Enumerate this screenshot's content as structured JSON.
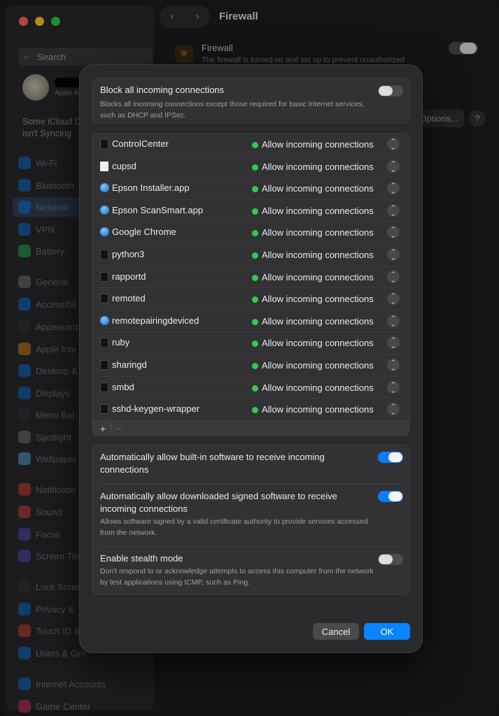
{
  "sidebar": {
    "search_placeholder": "Search",
    "profile_sub": "Apple A",
    "icloud_note": "Some iCloud D\nisn't Syncing",
    "items": [
      {
        "label": "Wi-Fi",
        "icon": "wifi-icon",
        "color": "#0a84ff"
      },
      {
        "label": "Bluetooth",
        "icon": "bluetooth-icon",
        "color": "#0a84ff"
      },
      {
        "label": "Network",
        "icon": "globe-icon",
        "color": "#0a84ff",
        "selected": true
      },
      {
        "label": "VPN",
        "icon": "vpn-icon",
        "color": "#0a84ff"
      },
      {
        "label": "Battery",
        "icon": "battery-icon",
        "color": "#30d158"
      },
      {
        "label": "General",
        "icon": "gear-icon",
        "color": "#8e8e93"
      },
      {
        "label": "Accessibil",
        "icon": "accessibility-icon",
        "color": "#0a84ff"
      },
      {
        "label": "Appearanc",
        "icon": "appearance-icon",
        "color": "#3a3a3c"
      },
      {
        "label": "Apple Inte",
        "icon": "apple-intelligence-icon",
        "color": "#ff9f0a"
      },
      {
        "label": "Desktop &",
        "icon": "desktop-icon",
        "color": "#0a84ff"
      },
      {
        "label": "Displays",
        "icon": "displays-icon",
        "color": "#0a84ff"
      },
      {
        "label": "Menu Bar",
        "icon": "menubar-icon",
        "color": "#3a3a3c"
      },
      {
        "label": "Spotlight",
        "icon": "spotlight-icon",
        "color": "#8e8e93"
      },
      {
        "label": "Wallpaper",
        "icon": "wallpaper-icon",
        "color": "#64d2ff"
      },
      {
        "label": "Notificatio",
        "icon": "notifications-icon",
        "color": "#ff453a"
      },
      {
        "label": "Sound",
        "icon": "sound-icon",
        "color": "#ff453a"
      },
      {
        "label": "Focus",
        "icon": "focus-icon",
        "color": "#5e5ce6"
      },
      {
        "label": "Screen Tim",
        "icon": "screentime-icon",
        "color": "#5e5ce6"
      },
      {
        "label": "Lock Scree",
        "icon": "lock-icon",
        "color": "#3a3a3c"
      },
      {
        "label": "Privacy &",
        "icon": "privacy-icon",
        "color": "#0a84ff"
      },
      {
        "label": "Touch ID &",
        "icon": "fingerprint-icon",
        "color": "#ff453a"
      },
      {
        "label": "Users & Gro",
        "icon": "users-icon",
        "color": "#0a84ff"
      },
      {
        "label": "Internet Accounts",
        "icon": "at-icon",
        "color": "#0a84ff"
      },
      {
        "label": "Game Center",
        "icon": "gamecenter-icon",
        "color": "#ff375f"
      }
    ]
  },
  "header": {
    "title": "Firewall",
    "back_icon": "chevron-left-icon",
    "forward_icon": "chevron-right-icon"
  },
  "firewall": {
    "label": "Firewall",
    "desc": "The firewall is turned on and set up to prevent unauthorized",
    "options_label": "Options...",
    "help_label": "?"
  },
  "dialog": {
    "block_all": {
      "title": "Block all incoming connections",
      "desc": "Blocks all incoming connections except those required for basic Internet services, such as DHCP and IPSec.",
      "enabled": false
    },
    "apps": [
      {
        "name": "ControlCenter",
        "icon": "terminal",
        "status": "Allow incoming connections"
      },
      {
        "name": "cupsd",
        "icon": "document",
        "status": "Allow incoming connections"
      },
      {
        "name": "Epson Installer.app",
        "icon": "app",
        "status": "Allow incoming connections"
      },
      {
        "name": "Epson ScanSmart.app",
        "icon": "app",
        "status": "Allow incoming connections"
      },
      {
        "name": "Google Chrome",
        "icon": "app",
        "status": "Allow incoming connections"
      },
      {
        "name": "python3",
        "icon": "terminal",
        "status": "Allow incoming connections"
      },
      {
        "name": "rapportd",
        "icon": "terminal",
        "status": "Allow incoming connections"
      },
      {
        "name": "remoted",
        "icon": "terminal",
        "status": "Allow incoming connections"
      },
      {
        "name": "remotepairingdeviced",
        "icon": "app",
        "status": "Allow incoming connections"
      },
      {
        "name": "ruby",
        "icon": "terminal",
        "status": "Allow incoming connections"
      },
      {
        "name": "sharingd",
        "icon": "terminal",
        "status": "Allow incoming connections"
      },
      {
        "name": "smbd",
        "icon": "terminal",
        "status": "Allow incoming connections"
      },
      {
        "name": "sshd-keygen-wrapper",
        "icon": "terminal",
        "status": "Allow incoming connections"
      }
    ],
    "list_footer": {
      "add": "+",
      "remove": "−"
    },
    "auto_builtin": {
      "title": "Automatically allow built-in software to receive incoming connections",
      "enabled": true
    },
    "auto_signed": {
      "title": "Automatically allow downloaded signed software to receive incoming connections",
      "desc": "Allows software signed by a valid certificate authority to provide services accessed from the network.",
      "enabled": true
    },
    "stealth": {
      "title": "Enable stealth mode",
      "desc": "Don't respond to or acknowledge attempts to access this computer from the network by test applications using ICMP, such as Ping.",
      "enabled": false
    },
    "cancel_label": "Cancel",
    "ok_label": "OK"
  },
  "colors": {
    "accent": "#0a84ff",
    "status_green": "#31c953",
    "dialog_bg": "#2a2a2c"
  }
}
